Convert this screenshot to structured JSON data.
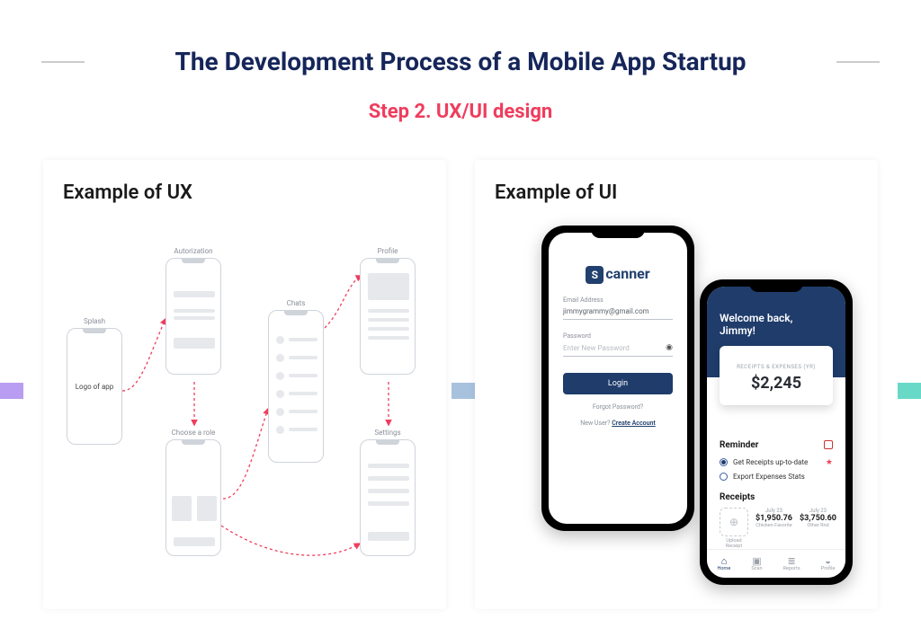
{
  "header": {
    "title": "The Development Process of a Mobile App Startup",
    "step": "Step 2. UX/UI design"
  },
  "ux": {
    "card_title": "Example of UX",
    "screens": {
      "splash": {
        "label": "Splash",
        "centerText": "Logo of app"
      },
      "auth": {
        "label": "Autorization"
      },
      "role": {
        "label": "Choose a role"
      },
      "chats": {
        "label": "Chats"
      },
      "profile": {
        "label": "Profile"
      },
      "settings": {
        "label": "Settings"
      }
    }
  },
  "ui": {
    "card_title": "Example of UI",
    "login": {
      "brand": "canner",
      "brand_badge": "S",
      "email_label": "Email Address",
      "email_value": "jimmygrammy@gmail.com",
      "password_label": "Password",
      "password_placeholder": "Enter New Password",
      "login_button": "Login",
      "forgot": "Forgot Password?",
      "new_user_prefix": "New User? ",
      "new_user_link": "Create Account"
    },
    "dashboard": {
      "welcome": "Welcome back,\nJimmy!",
      "card_caption": "RECEIPTS & EXPENSES (YR)",
      "card_amount": "$2,245",
      "reminder_title": "Reminder",
      "reminders": [
        {
          "text": "Get Receipts up-to-date",
          "checked": true,
          "star": true
        },
        {
          "text": "Export Expenses Stats",
          "checked": false,
          "star": false
        }
      ],
      "receipts_title": "Receipts",
      "upload_label": "Upload Receipt",
      "receipts": [
        {
          "date": "July 23",
          "amount": "$1,950.76",
          "vendor": "Chicken Favorite"
        },
        {
          "date": "July 23",
          "amount": "$3,750.60",
          "vendor": "Other Rnd"
        }
      ],
      "nav": [
        {
          "label": "Home",
          "icon": "⌂",
          "active": true
        },
        {
          "label": "Scan",
          "icon": "▣",
          "active": false
        },
        {
          "label": "Reports",
          "icon": "≣",
          "active": false
        },
        {
          "label": "Profile",
          "icon": "◒",
          "active": false
        }
      ]
    }
  }
}
